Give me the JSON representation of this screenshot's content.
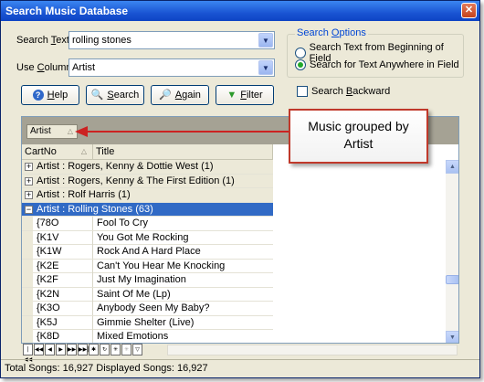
{
  "window": {
    "title": "Search Music Database"
  },
  "search": {
    "text_label_pre": "Search ",
    "text_label_u": "T",
    "text_label_post": "ext:",
    "text_value": "rolling stones",
    "column_label_pre": "Use ",
    "column_label_u": "C",
    "column_label_post": "olumn:",
    "column_value": "Artist"
  },
  "options": {
    "legend_pre": "Search ",
    "legend_u": "O",
    "legend_post": "ptions",
    "radio1": "Search Text from Beginning of Field",
    "radio2": "Search for Text Anywhere in Field",
    "backward_pre": "Search ",
    "backward_u": "B",
    "backward_post": "ackward"
  },
  "buttons": {
    "help": {
      "u": "H",
      "rest": "elp"
    },
    "search": {
      "u": "S",
      "rest": "earch"
    },
    "again": {
      "u": "A",
      "rest": "gain"
    },
    "filter": {
      "u": "F",
      "rest": "ilter"
    }
  },
  "grid": {
    "group_chip": "Artist",
    "columns": [
      "CartNo",
      "Title"
    ],
    "groups_collapsed": [
      "Artist : Rogers, Kenny & Dottie West (1)",
      "Artist : Rogers, Kenny & The First Edition (1)",
      "Artist : Rolf Harris (1)"
    ],
    "group_expanded": "Artist : Rolling Stones (63)",
    "rows": [
      {
        "cart": "{78O",
        "title": "Fool To Cry"
      },
      {
        "cart": "{K1V",
        "title": "You Got Me Rocking"
      },
      {
        "cart": "{K1W",
        "title": "Rock And A Hard Place"
      },
      {
        "cart": "{K2E",
        "title": "Can't You Hear Me Knocking"
      },
      {
        "cart": "{K2F",
        "title": "Just My Imagination"
      },
      {
        "cart": "{K2N",
        "title": "Saint Of Me (Lp)"
      },
      {
        "cart": "{K3O",
        "title": "Anybody Seen My Baby?"
      },
      {
        "cart": "{K5J",
        "title": "Gimmie Shelter (Live)"
      },
      {
        "cart": "{K8D",
        "title": "Mixed Emotions"
      }
    ]
  },
  "callout": {
    "line1": "Music grouped by",
    "line2": "Artist"
  },
  "status": "Total Songs: 16,927  Displayed Songs: 16,927"
}
